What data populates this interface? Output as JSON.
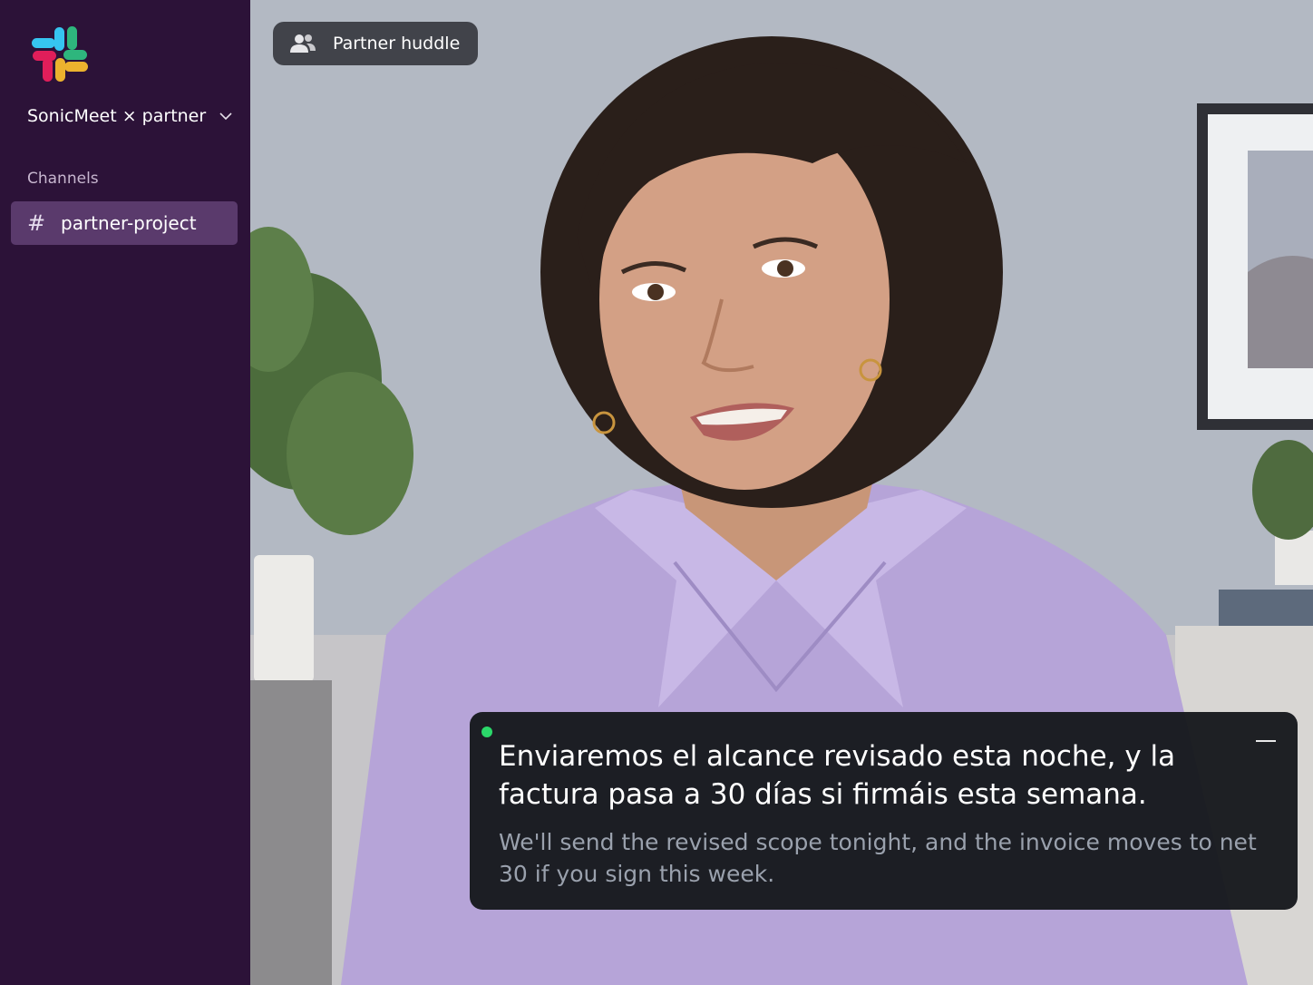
{
  "sidebar": {
    "workspace_name": "SonicMeet × partner",
    "section_label": "Channels",
    "channels": [
      {
        "label": "partner-project",
        "active": true
      }
    ]
  },
  "huddle": {
    "label": "Partner huddle",
    "icon": "people-icon"
  },
  "caption": {
    "status": "live",
    "original": "Enviaremos el alcance revisado esta noche, y la factura pasa a 30 días si firmáis esta semana.",
    "translation": "We'll send the revised scope tonight, and the invoice moves to net 30 if you sign this week."
  },
  "colors": {
    "sidebar_bg": "#2c1238",
    "active_channel_bg": "#5a3a6c",
    "live_indicator": "#2bd86a",
    "caption_bg": "#16181c"
  }
}
